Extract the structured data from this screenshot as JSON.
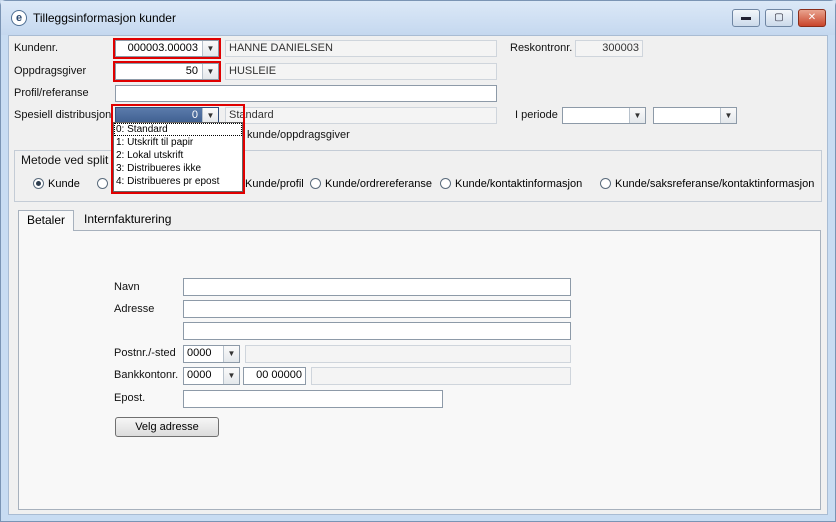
{
  "window": {
    "title": "Tilleggsinformasjon kunder",
    "app_icon": "e-app-icon"
  },
  "titlebar_buttons": {
    "minimize": "▬",
    "maximize": "▢",
    "close": "✕"
  },
  "form": {
    "kundenr": {
      "label": "Kundenr.",
      "value": "000003.00003",
      "name": "HANNE DANIELSEN"
    },
    "reskontro": {
      "label": "Reskontronr.",
      "value": "300003"
    },
    "oppdragsgiver": {
      "label": "Oppdragsgiver",
      "value": "50",
      "name": "HUSLEIE"
    },
    "profil": {
      "label": "Profil/referanse",
      "value": ""
    },
    "distribusjon": {
      "label": "Spesiell distribusjon",
      "value": "0",
      "text": "Standard"
    },
    "periode": {
      "label": "I periode",
      "from": "",
      "to": ""
    },
    "behind_text": "kunde/oppdragsgiver"
  },
  "dropdown": {
    "items": [
      "0: Standard",
      "1: Utskrift til papir",
      "2: Lokal utskrift",
      "3: Distribueres ikke",
      "4: Distribueres pr epost"
    ]
  },
  "split": {
    "title": "Metode ved split",
    "options": [
      "Kunde",
      "Kunde/profil",
      "Kunde/ordrereferanse",
      "Kunde/kontaktinformasjon",
      "Kunde/saksreferanse/kontaktinformasjon"
    ]
  },
  "tabs": [
    "Betaler",
    "Internfakturering"
  ],
  "betaler": {
    "navn_label": "Navn",
    "adresse_label": "Adresse",
    "postnr_label": "Postnr./-sted",
    "postnr_value": "0000",
    "bankkonto_label": "Bankkontonr.",
    "bank_part1": "0000",
    "bank_part2": "00 00000",
    "epost_label": "Epost.",
    "velg_button": "Velg adresse"
  }
}
